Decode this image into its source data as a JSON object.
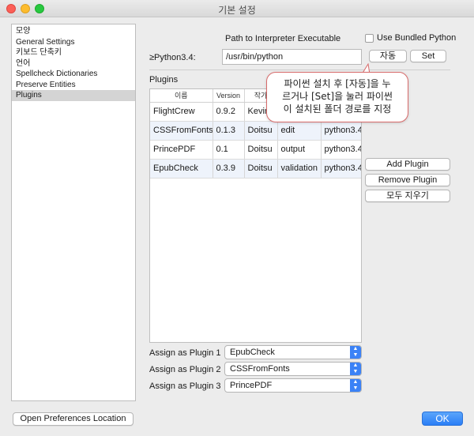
{
  "window": {
    "title": "기본 설정"
  },
  "sidebar": {
    "items": [
      {
        "label": "모양"
      },
      {
        "label": "General Settings"
      },
      {
        "label": "키보드 단축키"
      },
      {
        "label": "언어"
      },
      {
        "label": "Spellcheck Dictionaries"
      },
      {
        "label": "Preserve Entities"
      },
      {
        "label": "Plugins",
        "selected": true
      }
    ]
  },
  "interpreter": {
    "header": "Path to Interpreter Executable",
    "bundled_label": "Use Bundled Python",
    "bundled_checked": false,
    "python_label": "≥Python3.4:",
    "path_value": "/usr/bin/python",
    "auto_button": "자동",
    "set_button": "Set"
  },
  "plugins": {
    "section_title": "Plugins",
    "columns": [
      "이름",
      "Version",
      "작가",
      "",
      ""
    ],
    "rows": [
      [
        "FlightCrew",
        "0.9.2",
        "Kevin",
        "",
        ""
      ],
      [
        "CSSFromFonts",
        "0.1.3",
        "Doitsu",
        "edit",
        "python3.4"
      ],
      [
        "PrincePDF",
        "0.1",
        "Doitsu",
        "output",
        "python3.4"
      ],
      [
        "EpubCheck",
        "0.3.9",
        "Doitsu",
        "validation",
        "python3.4"
      ]
    ],
    "add_button": "Add Plugin",
    "remove_button": "Remove Plugin",
    "clear_button": "모두 지우기"
  },
  "tooltip": {
    "line1": "파이썬 설치 후 [자동]을 누",
    "line2": "르거나 [Set]을 눌러 파이썬",
    "line3": "이 설치된 폴더 경로를 지정"
  },
  "assign": [
    {
      "label": "Assign as Plugin 1",
      "value": "EpubCheck"
    },
    {
      "label": "Assign as Plugin 2",
      "value": "CSSFromFonts"
    },
    {
      "label": "Assign as Plugin 3",
      "value": "PrincePDF"
    }
  ],
  "footer": {
    "open_location_button": "Open Preferences Location",
    "ok_button": "OK"
  },
  "colors": {
    "accent": "#2a7ef6",
    "tooltip_border": "#d86b6b",
    "close": "#fc5f57",
    "minimize": "#fdbc2e",
    "maximize": "#28c840"
  }
}
